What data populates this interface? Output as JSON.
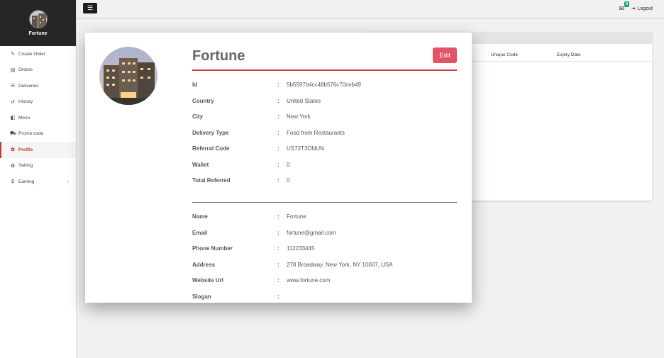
{
  "app": {
    "brand": "Fortune"
  },
  "sidebar": {
    "items": [
      {
        "label": "Create Order",
        "icon": "edit-icon"
      },
      {
        "label": "Orders",
        "icon": "list-icon"
      },
      {
        "label": "Deliveries",
        "icon": "list-icon"
      },
      {
        "label": "History",
        "icon": "history-icon"
      },
      {
        "label": "Menu",
        "icon": "menu-icon"
      },
      {
        "label": "Promo code",
        "icon": "cart-icon"
      },
      {
        "label": "Profile",
        "icon": "gear-icon"
      },
      {
        "label": "Setting",
        "icon": "gear-icon"
      },
      {
        "label": "Earning",
        "icon": "dollar-icon"
      }
    ],
    "active": "Profile"
  },
  "topbar": {
    "badge_count": "3",
    "logout_label": "Logout"
  },
  "background_table": {
    "columns": [
      "Unique Code",
      "Expiry Date"
    ]
  },
  "profile": {
    "name": "Fortune",
    "edit_label": "Edit",
    "section1": [
      {
        "label": "Id",
        "value": "5b5597b4cc48b576c70ceb49"
      },
      {
        "label": "Country",
        "value": "United States"
      },
      {
        "label": "City",
        "value": "New York"
      },
      {
        "label": "Delivery Type",
        "value": "Food from Restaurants"
      },
      {
        "label": "Referral Code",
        "value": "US72T3ONUN"
      },
      {
        "label": "Wallet",
        "value": "0"
      },
      {
        "label": "Total Referred",
        "value": "0"
      }
    ],
    "section2": [
      {
        "label": "Name",
        "value": "Fortune"
      },
      {
        "label": "Email",
        "value": "fortune@gmail.com"
      },
      {
        "label": "Phone Number",
        "value": "112233445"
      },
      {
        "label": "Address",
        "value": "278 Broadway, New York, NY 10007, USA"
      },
      {
        "label": "Website Url",
        "value": "www.fortune.com"
      },
      {
        "label": "Slogan",
        "value": ""
      }
    ]
  },
  "colors": {
    "accent": "#d9383f",
    "edit_button": "#e25466",
    "badge": "#16a085",
    "sidebar_header": "#262626"
  }
}
